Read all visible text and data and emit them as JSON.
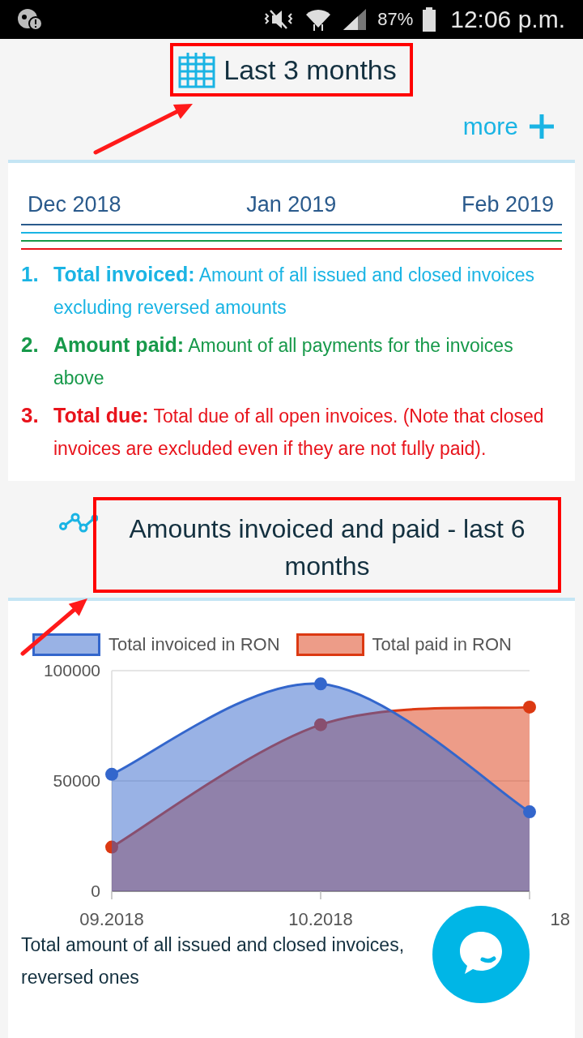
{
  "status_bar": {
    "battery": "87%",
    "time": "12:06 p.m."
  },
  "period": {
    "title": "Last 3 months",
    "more": "more"
  },
  "months": [
    "Dec 2018",
    "Jan 2019",
    "Feb 2019"
  ],
  "definitions": [
    {
      "number": "1.",
      "term": "Total invoiced:",
      "text": "Amount of all issued and closed invoices excluding reversed amounts",
      "color": "#1ab4e4"
    },
    {
      "number": "2.",
      "term": "Amount paid:",
      "text": "Amount of all payments for the invoices above",
      "color": "#17994a"
    },
    {
      "number": "3.",
      "term": "Total due:",
      "text": "Total due of all open invoices. (Note that closed invoices are excluded even if they are not fully paid).",
      "color": "#e8131b"
    }
  ],
  "history": {
    "title": "Amounts invoiced and paid - last 6 months",
    "chart_data": {
      "type": "area",
      "categories": [
        "09.2018",
        "10.2018",
        "18"
      ],
      "ylim": [
        0,
        100000
      ],
      "yticks": [
        0,
        50000,
        100000
      ],
      "series": [
        {
          "name": "Total invoiced in RON",
          "color": "#3366cc",
          "values": [
            53000,
            94000,
            36000
          ]
        },
        {
          "name": "Total paid in RON",
          "color": "#dc3912",
          "values": [
            20000,
            75500,
            83500
          ]
        }
      ]
    },
    "caption_lines": [
      "Total amount of all issued and closed invoices,",
      "reversed ones"
    ]
  }
}
